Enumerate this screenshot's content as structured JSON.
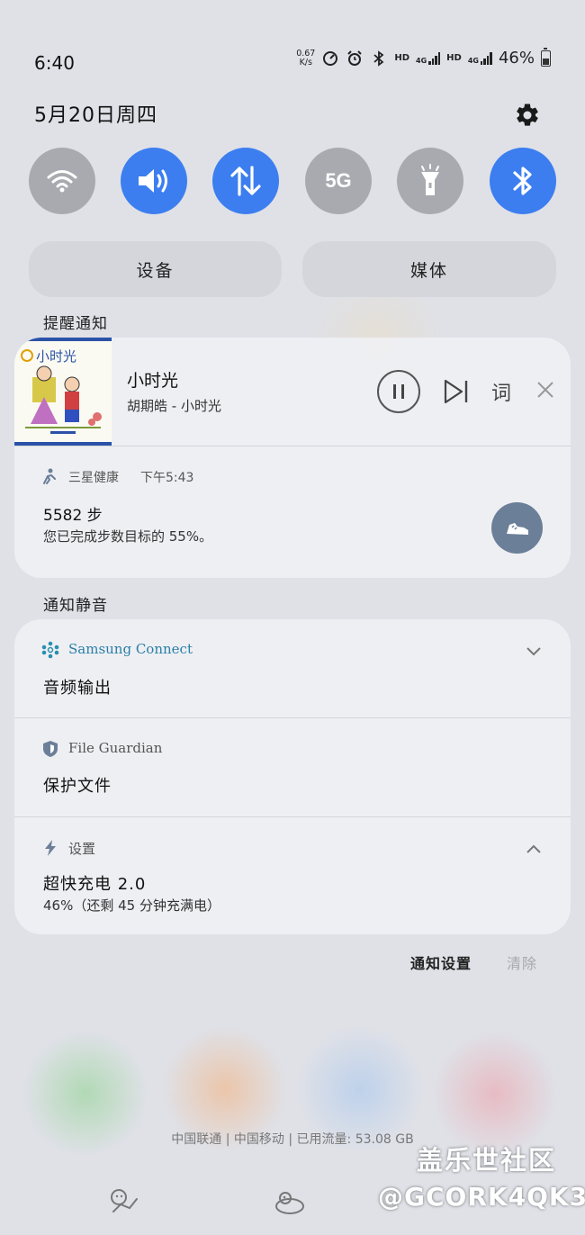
{
  "status_bar": {
    "time": "6:40",
    "net_speed_value": "0.67",
    "net_speed_unit": "K/s",
    "hd1": "HD",
    "hd2": "HD",
    "net1": "4G",
    "net2": "4G",
    "battery": "46%"
  },
  "header": {
    "date": "5月20日周四"
  },
  "quick_toggles": [
    {
      "name": "wifi",
      "on": false,
      "icon": "wifi-icon"
    },
    {
      "name": "sound",
      "on": true,
      "icon": "speaker-icon"
    },
    {
      "name": "mobile-data",
      "on": true,
      "icon": "data-arrows-icon"
    },
    {
      "name": "5g",
      "on": false,
      "icon": "5g-icon",
      "label": "5G"
    },
    {
      "name": "flashlight",
      "on": false,
      "icon": "flashlight-icon"
    },
    {
      "name": "bluetooth",
      "on": true,
      "icon": "bluetooth-icon"
    }
  ],
  "panels": {
    "devices": "设备",
    "media": "媒体"
  },
  "sections": {
    "alerts": "提醒通知",
    "silent": "通知静音"
  },
  "music": {
    "title": "小时光",
    "artist": "胡期皓 - 小时光",
    "lyrics": "词",
    "album_text": "小时光"
  },
  "health": {
    "app": "三星健康",
    "time": "下午5:43",
    "title": "5582 步",
    "subtitle": "您已完成步数目标的 55%。"
  },
  "silent_notifications": [
    {
      "app": "Samsung Connect",
      "title": "音频输出",
      "subtitle": ""
    },
    {
      "app": "File Guardian",
      "title": "保护文件",
      "subtitle": ""
    },
    {
      "app": "设置",
      "title": "超快充电 2.0",
      "subtitle": "46%（还剩 45 分钟充满电）"
    }
  ],
  "footer": {
    "notif_settings": "通知设置",
    "clear": "清除",
    "carrier": "中国联通 | 中国移动 | 已用流量: 53.08 GB"
  },
  "watermark": {
    "line1": "盖乐世社区",
    "line2": "@GCORK4QK3"
  },
  "colors": {
    "accent": "#3c7ef0",
    "toggle_off": "#a9aab0",
    "card": "#eeeff3",
    "shoe_btn": "#6b7f98"
  }
}
